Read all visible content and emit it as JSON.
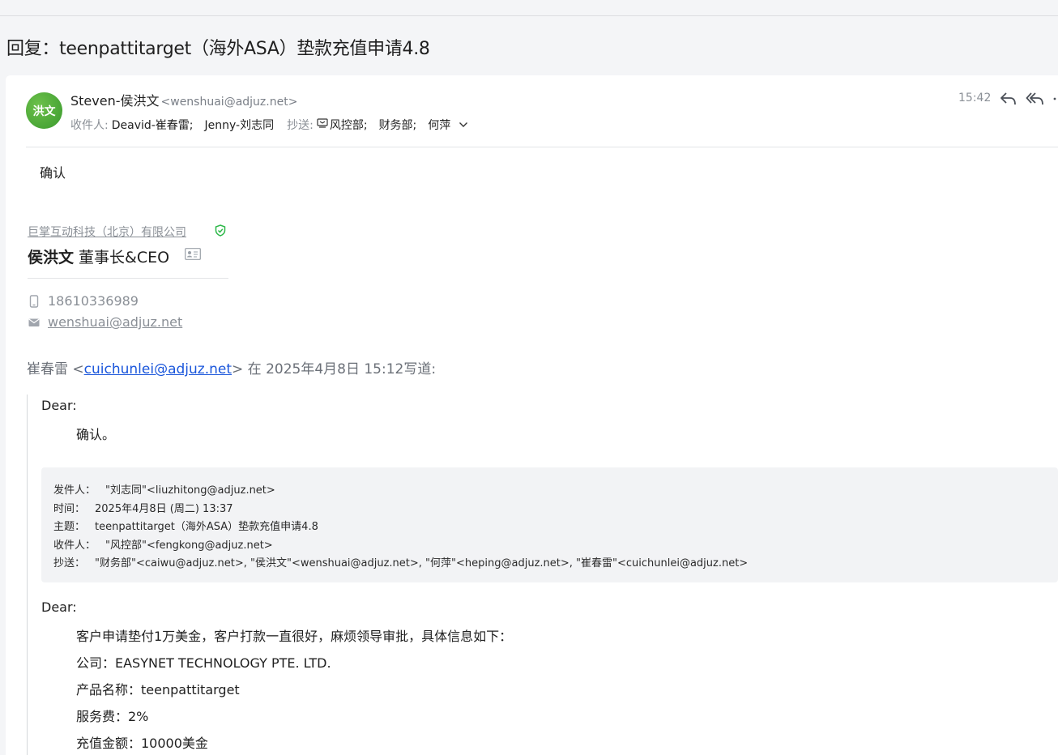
{
  "subject": "回复：teenpattitarget（海外ASA）垫款充值申请4.8",
  "sender": {
    "avatar_text": "洪文",
    "name": "Steven-侯洪文",
    "address": "<wenshuai@adjuz.net>",
    "time": "15:42"
  },
  "recipients": {
    "to_label": "收件人:",
    "to": [
      "Deavid-崔春雷;",
      "Jenny-刘志同"
    ],
    "cc_label": "抄送:",
    "cc": [
      "风控部;",
      "财务部;",
      "何萍"
    ]
  },
  "body": {
    "confirm": "确认"
  },
  "signature": {
    "company": "巨掌互动科技（北京）有限公司",
    "name": "侯洪文",
    "role": "董事长&CEO",
    "phone": "18610336989",
    "email": "wenshuai@adjuz.net"
  },
  "quote": {
    "author": "崔春雷 <",
    "author_email": "cuichunlei@adjuz.net",
    "suffix": "> 在 2025年4月8日 15:12写道:",
    "dear": "Dear:",
    "confirm": "确认。"
  },
  "forwarded": {
    "from_label": "发件人：",
    "from": "\"刘志同\"<liuzhitong@adjuz.net>",
    "time_label": "时间：",
    "time": "2025年4月8日 (周二) 13:37",
    "subject_label": "主题：",
    "subject": "teenpattitarget（海外ASA）垫款充值申请4.8",
    "to_label": "收件人：",
    "to": "\"风控部\"<fengkong@adjuz.net>",
    "cc_label": "抄送：",
    "cc": "\"财务部\"<caiwu@adjuz.net>, \"侯洪文\"<wenshuai@adjuz.net>, \"何萍\"<heping@adjuz.net>, \"崔春雷\"<cuichunlei@adjuz.net>"
  },
  "original": {
    "dear": "Dear:",
    "lines": [
      " 客户申请垫付1万美金，客户打款一直很好，麻烦领导审批，具体信息如下：",
      "公司：EASYNET TECHNOLOGY PTE. LTD.",
      "产品名称：teenpattitarget",
      "服务费：2%",
      "充值金额：10000美金"
    ]
  }
}
